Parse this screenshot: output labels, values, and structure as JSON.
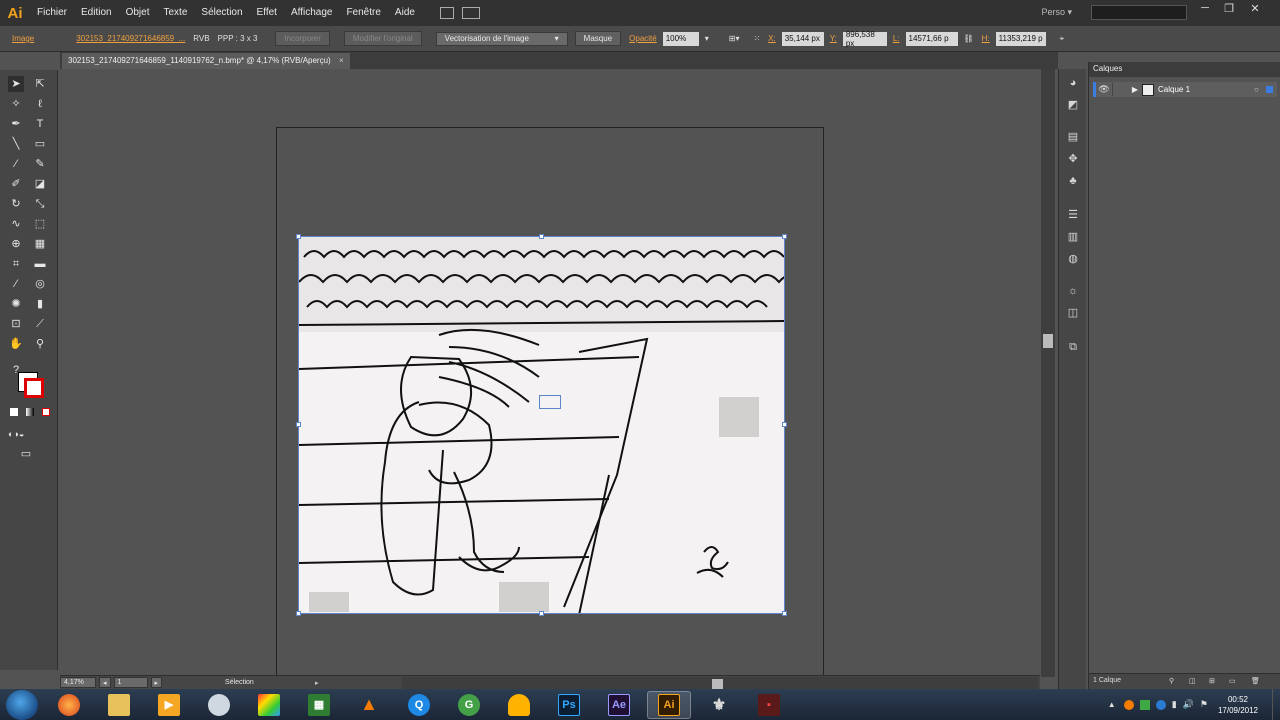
{
  "menubar": {
    "logo": "Ai",
    "items": [
      "Fichier",
      "Edition",
      "Objet",
      "Texte",
      "Sélection",
      "Effet",
      "Affichage",
      "Fenêtre",
      "Aide"
    ],
    "workspace": "Perso"
  },
  "controlbar": {
    "type_label": "Image",
    "filename": "302153_217409271646859_...",
    "color_mode": "RVB",
    "ppp": "PPP : 3 x 3",
    "embed_btn": "Incorporer",
    "edit_original_btn": "Modifier l'original",
    "trace_dd": "Vectorisation de l'image",
    "mask_btn": "Masque",
    "opacity_label": "Opacité",
    "opacity_value": "100%",
    "x_label": "X:",
    "x_value": "35,144 px",
    "y_label": "Y:",
    "y_value": "896,538 px",
    "w_label": "L:",
    "w_value": "14571,66 p",
    "h_label": "H:",
    "h_value": "11353,219 p"
  },
  "document": {
    "tab_title": "302153_217409271646859_1140919762_n.bmp* @ 4,17% (RVB/Aperçu)"
  },
  "statusbar": {
    "zoom": "4,17%",
    "artboard_num": "1",
    "tool_name": "Sélection"
  },
  "layers_panel": {
    "tab_label": "Calques",
    "layer_name": "Calque 1",
    "footer": "1 Calque"
  },
  "taskbar": {
    "time": "00:52",
    "date": "17/09/2012",
    "apps": [
      "Firefox",
      "Explorer",
      "Media",
      "Steam",
      "Paint",
      "Excel",
      "VLC",
      "QuickTime",
      "Greenshot",
      "Folder",
      "Ps",
      "Ae",
      "Ai",
      "Skyrim",
      "Game"
    ]
  },
  "colors": {
    "ai_orange": "#f3a21c",
    "selection_blue": "#5f85c9",
    "ps_blue": "#31a8ff",
    "ae_purple": "#9999ff"
  }
}
